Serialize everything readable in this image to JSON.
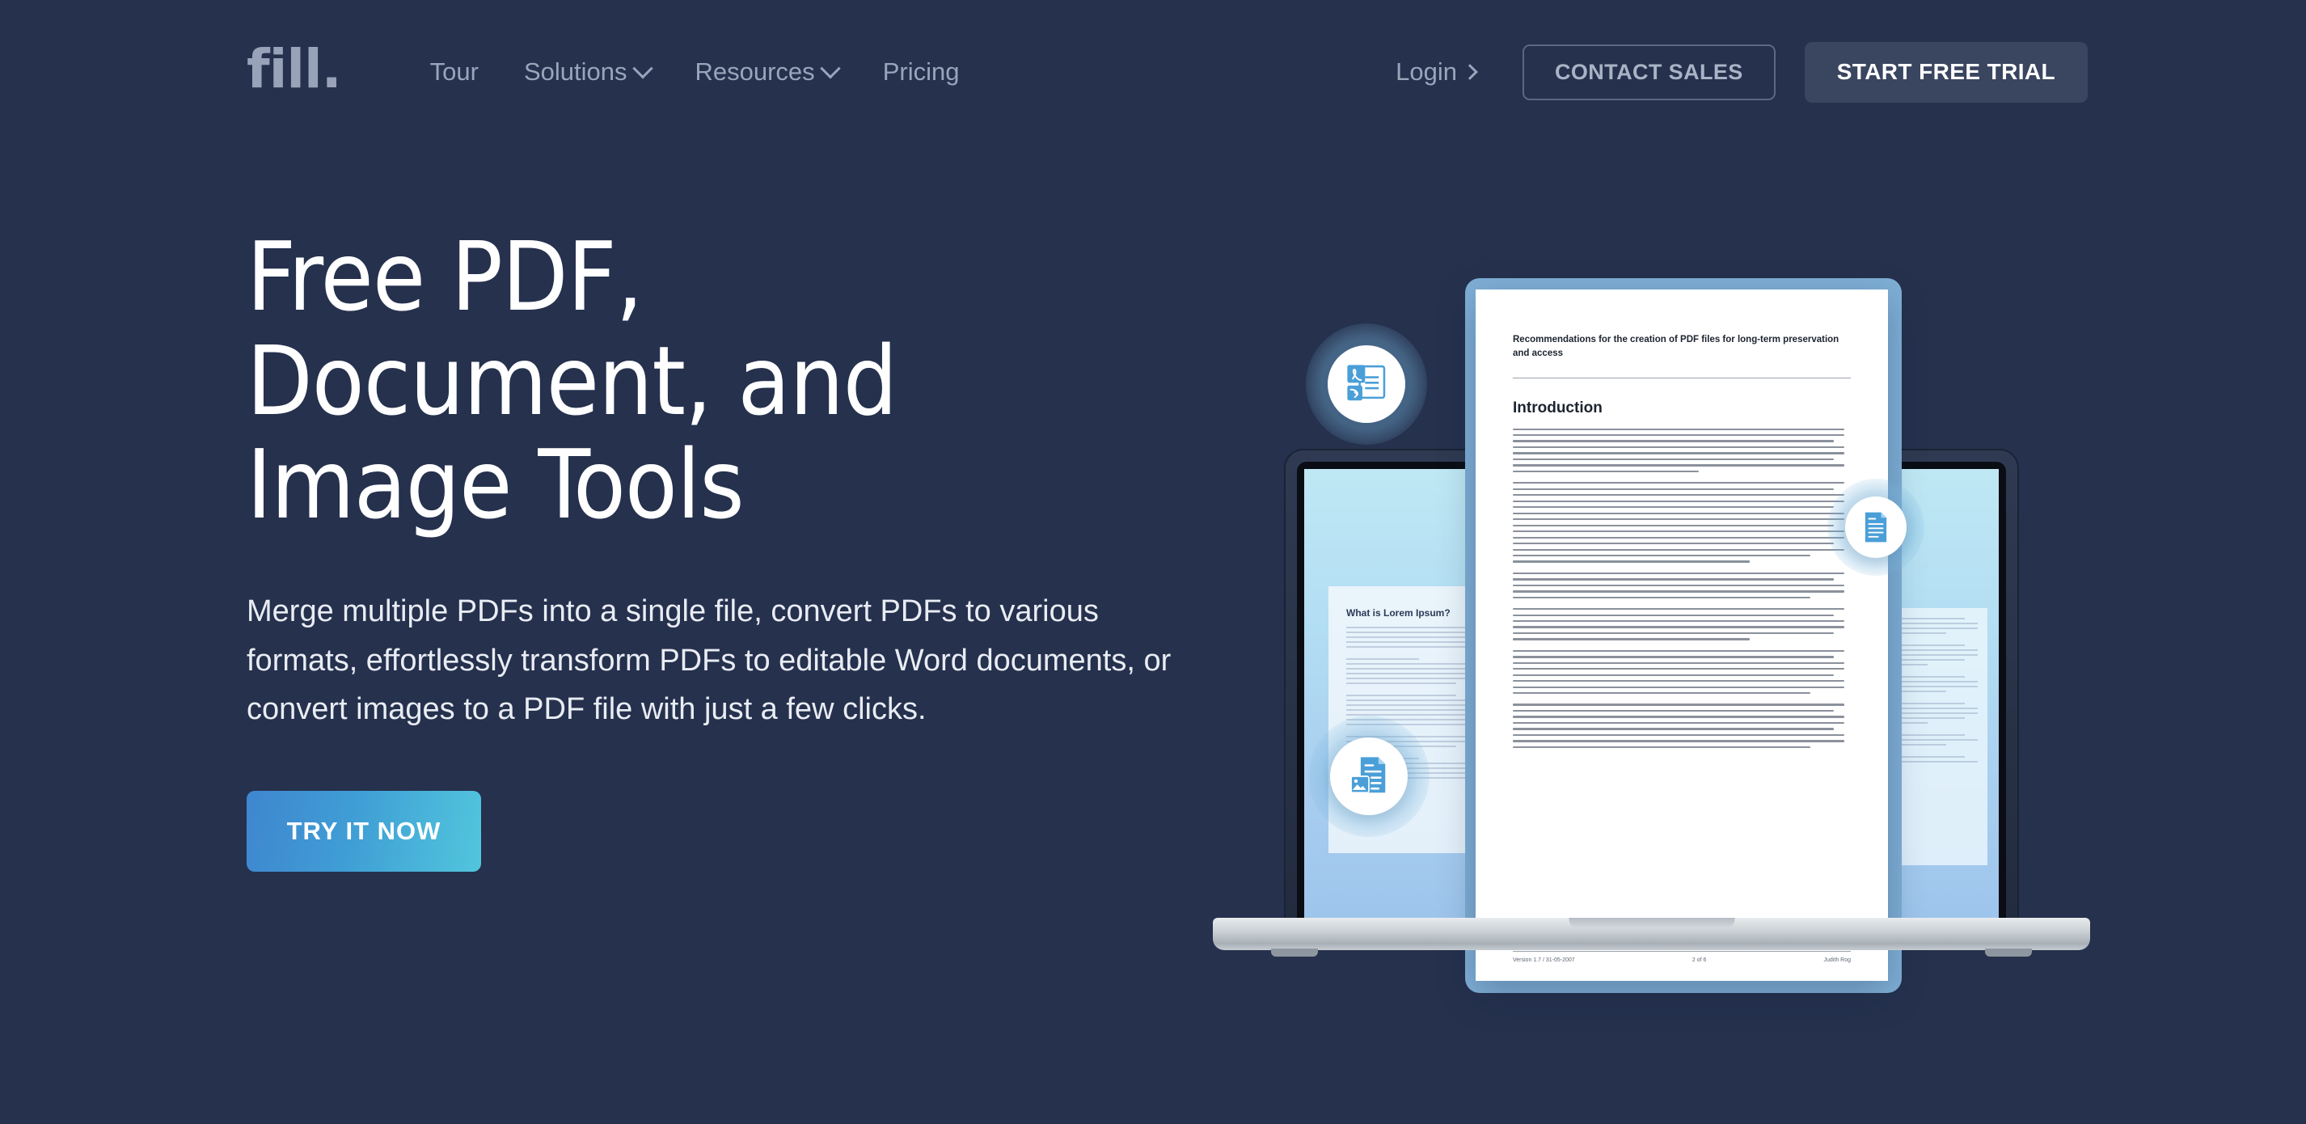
{
  "theme": {
    "background": "#25314d",
    "nav_text": "#9aa5bb",
    "logo_color": "#98a2b8",
    "cta_gradient_from": "#3f86cf",
    "cta_gradient_to": "#52c6dd",
    "solid_button_bg": "#3a4560"
  },
  "header": {
    "logo": "fill.",
    "nav": [
      {
        "label": "Tour",
        "has_dropdown": false
      },
      {
        "label": "Solutions",
        "has_dropdown": true
      },
      {
        "label": "Resources",
        "has_dropdown": true
      },
      {
        "label": "Pricing",
        "has_dropdown": false
      }
    ],
    "login_label": "Login",
    "contact_sales_label": "CONTACT SALES",
    "start_trial_label": "START FREE TRIAL"
  },
  "hero": {
    "headline": "Free PDF, Document, and Image Tools",
    "subcopy": "Merge multiple PDFs into a single file, convert PDFs to various formats, effortlessly transform PDFs to editable Word documents, or convert images to a PDF file with just a few clicks.",
    "cta_label": "TRY IT NOW"
  },
  "illustration": {
    "device": "laptop",
    "document": {
      "title": "Recommendations for the creation of PDF files for long-term preservation and access",
      "heading": "Introduction",
      "footer_left": "Version 1.7 / 31-05-2007",
      "footer_center": "2 of 6",
      "footer_right": "Judith Rog"
    },
    "background_page_left_title": "What is Lorem Ipsum?",
    "badges": [
      {
        "icon": "pdf-convert-icon",
        "position": "top-left"
      },
      {
        "icon": "document-icon",
        "position": "right"
      },
      {
        "icon": "image-to-document-icon",
        "position": "bottom-left"
      }
    ]
  }
}
